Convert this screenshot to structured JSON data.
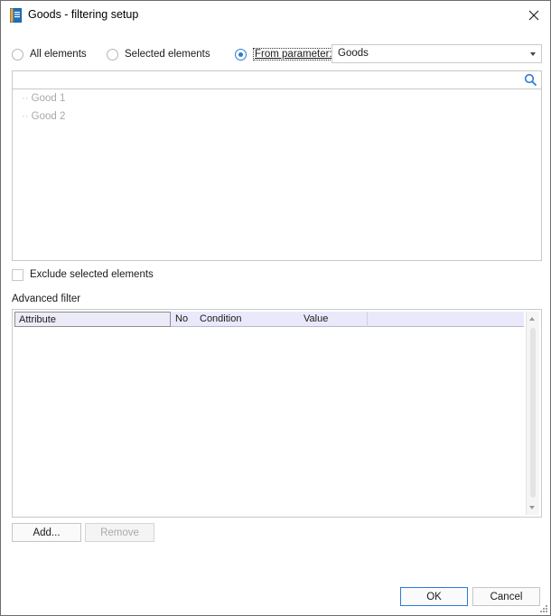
{
  "window": {
    "title": "Goods - filtering setup",
    "icon": "dictionary-icon",
    "close": "close-icon"
  },
  "selection_mode": {
    "options": [
      {
        "label": "All elements",
        "checked": false
      },
      {
        "label": "Selected elements",
        "checked": false
      },
      {
        "label": "From parameter:",
        "checked": true
      }
    ],
    "parameter": {
      "value": "Goods"
    }
  },
  "search": {
    "value": "",
    "icon": "search-icon"
  },
  "tree": {
    "items": [
      "Good 1",
      "Good 2"
    ],
    "branch_glyph": "··"
  },
  "exclude": {
    "label": "Exclude selected elements",
    "checked": false
  },
  "advanced_filter": {
    "label": "Advanced filter",
    "columns": [
      "Attribute",
      "No",
      "Condition",
      "Value"
    ],
    "rows": []
  },
  "buttons": {
    "add": "Add...",
    "remove": "Remove",
    "ok": "OK",
    "cancel": "Cancel"
  },
  "colors": {
    "accent": "#2b7bd3",
    "grid_header": "#e9e9fb",
    "disabled_text": "#a9a9a9"
  }
}
